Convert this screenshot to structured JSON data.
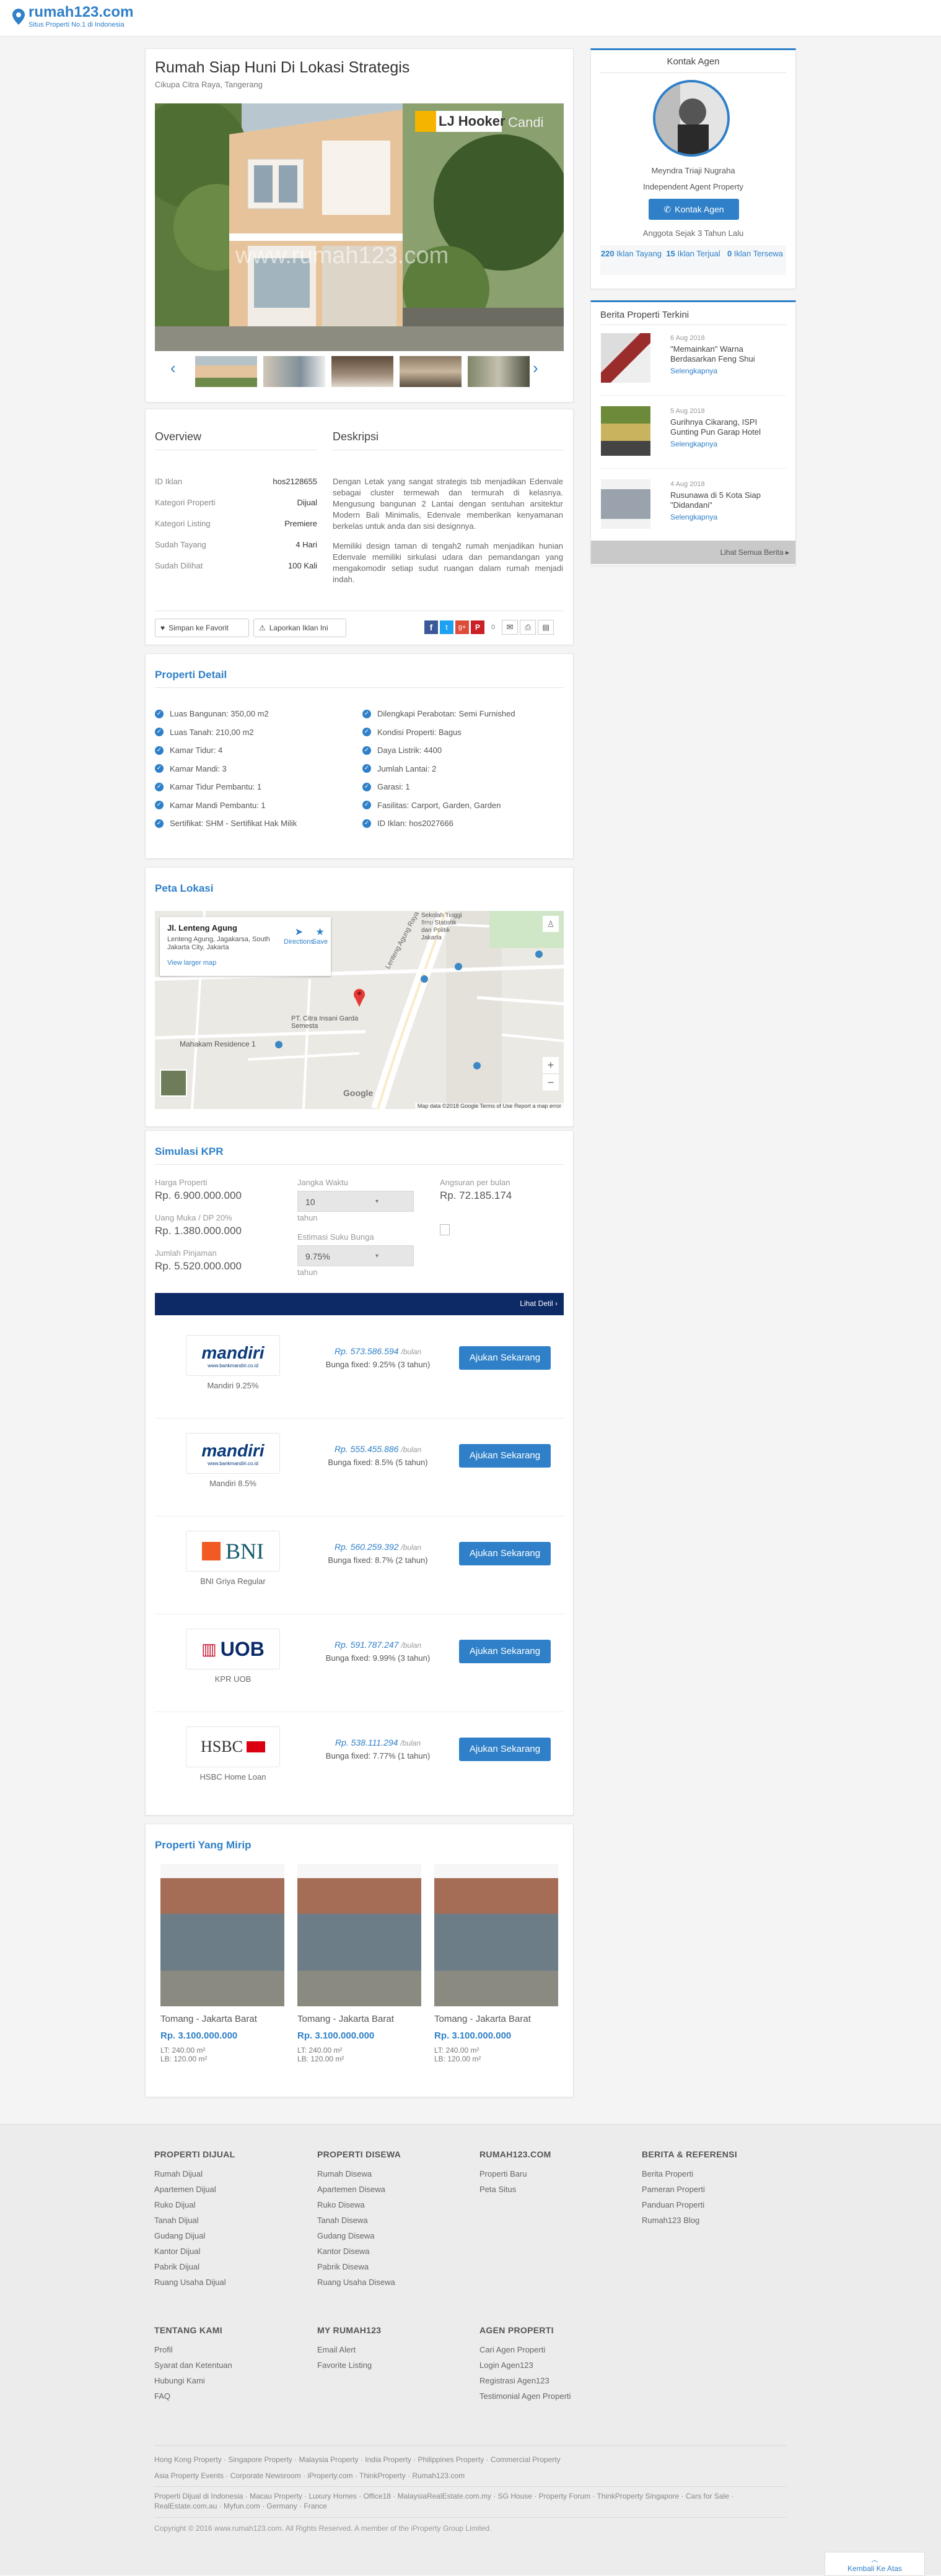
{
  "brand": {
    "name": "rumah123.com",
    "tagline": "Situs Properti No.1 di Indonesia",
    "accent": "#2f80c8"
  },
  "listing": {
    "title": "Rumah Siap Huni Di Lokasi Strategis",
    "location": "Cikupa Citra Raya, Tangerang",
    "watermark": "www.rumah123.com",
    "agency_sign": "LJ Hooker",
    "sign_extra": "Candi"
  },
  "overview": {
    "title": "Overview",
    "rows": [
      {
        "k": "ID Iklan",
        "v": "hos2128655"
      },
      {
        "k": "Kategori Properti",
        "v": "Dijual"
      },
      {
        "k": "Kategori Listing",
        "v": "Premiere"
      },
      {
        "k": "Sudah Tayang",
        "v": "4 Hari"
      },
      {
        "k": "Sudah Dilihat",
        "v": "100 Kali"
      }
    ]
  },
  "description": {
    "title": "Deskripsi",
    "p1": "Dengan Letak yang sangat strategis tsb menjadikan Edenvale sebagai cluster termewah dan termurah di kelasnya. Mengusung bangunan 2 Lantai dengan sentuhan arsitektur Modern Bali Minimalis, Edenvale memberikan kenyamanan berkelas untuk anda dan sisi designnya.",
    "p2": "Memiliki design taman di tengah2 rumah menjadikan hunian Edenvale memiliki sirkulasi udara dan pemandangan yang mengakomodir setiap sudut ruangan dalam rumah menjadi indah."
  },
  "actions": {
    "save_label": "Simpan ke Favorit",
    "report_label": "Laporkan Iklan Ini",
    "share_count": "0"
  },
  "detail": {
    "title": "Properti Detail",
    "left": [
      "Luas Bangunan: 350,00 m2",
      "Luas Tanah: 210,00 m2",
      "Kamar Tidur: 4",
      "Kamar Mandi: 3",
      "Kamar Tidur Pembantu: 1",
      "Kamar Mandi Pembantu: 1",
      "Sertifikat: SHM - Sertifikat Hak Milik"
    ],
    "right": [
      "Dilengkapi Perabotan: Semi Furnished",
      "Kondisi Properti: Bagus",
      "Daya Listrik: 4400",
      "Jumlah Lantai: 2",
      "Garasi: 1",
      "Fasilitas: Carport, Garden, Garden",
      "ID Iklan: hos2027666"
    ]
  },
  "map": {
    "title": "Peta Lokasi",
    "place_name": "Jl. Lenteng Agung",
    "place_addr": "Lenteng Agung, Jagakarsa, South Jakarta City, Jakarta",
    "larger_map": "View larger map",
    "directions": "Directions",
    "save": "Save",
    "street": "Lenteng Agung Raya",
    "poi1": "Mahakam Residence 1",
    "poi2": "PT. Citra Insani Garda Semesta",
    "poi3": "Sekolah Tinggi Ilmu Statistik dan Politik Jakarta",
    "footer": "Map data ©2018 Google   Terms of Use   Report a map error",
    "google": "Google"
  },
  "kpr": {
    "title": "Simulasi KPR",
    "harga_label": "Harga Properti",
    "harga": "Rp. 6.900.000.000",
    "dp_label": "Uang Muka / DP 20%",
    "dp": "Rp. 1.380.000.000",
    "pinjaman_label": "Jumlah Pinjaman",
    "pinjaman": "Rp. 5.520.000.000",
    "jangka_label": "Jangka Waktu",
    "jangka": "10",
    "jangka_unit": "tahun",
    "bunga_label": "Estimasi Suku Bunga",
    "bunga": "9.75%",
    "bunga_unit": "tahun",
    "angsuran_label": "Angsuran per bulan",
    "angsuran": "Rp. 72.185.174",
    "detail_link": "Lihat Detil ›",
    "banks": [
      {
        "logo": "mandiri",
        "logo_sub": "www.bankmandiri.co.id",
        "caption": "Mandiri 9.25%",
        "amount": "Rp. 573.586.594",
        "unit": "/bulan",
        "bunga": "Bunga fixed: 9.25% (3 tahun)",
        "btn": "Ajukan Sekarang"
      },
      {
        "logo": "mandiri",
        "logo_sub": "www.bankmandiri.co.id",
        "caption": "Mandiri 8.5%",
        "amount": "Rp. 555.455.886",
        "unit": "/bulan",
        "bunga": "Bunga fixed: 8.5% (5 tahun)",
        "btn": "Ajukan Sekarang"
      },
      {
        "logo": "BNI",
        "logo_sub": "",
        "caption": "BNI Griya Regular",
        "amount": "Rp. 560.259.392",
        "unit": "/bulan",
        "bunga": "Bunga fixed: 8.7% (2 tahun)",
        "btn": "Ajukan Sekarang"
      },
      {
        "logo": "UOB",
        "logo_sub": "",
        "caption": "KPR UOB",
        "amount": "Rp. 591.787.247",
        "unit": "/bulan",
        "bunga": "Bunga fixed: 9.99% (3 tahun)",
        "btn": "Ajukan Sekarang"
      },
      {
        "logo": "HSBC",
        "logo_sub": "",
        "caption": "HSBC Home Loan",
        "amount": "Rp. 538.111.294",
        "unit": "/bulan",
        "bunga": "Bunga fixed: 7.77% (1 tahun)",
        "btn": "Ajukan Sekarang"
      }
    ]
  },
  "similar": {
    "title": "Properti Yang Mirip",
    "items": [
      {
        "location": "Tomang - Jakarta Barat",
        "price": "Rp. 3.100.000.000",
        "lt": "LT: 240.00 m²",
        "lb": "LB: 120.00 m²"
      },
      {
        "location": "Tomang - Jakarta Barat",
        "price": "Rp. 3.100.000.000",
        "lt": "LT: 240.00 m²",
        "lb": "LB: 120.00 m²"
      },
      {
        "location": "Tomang - Jakarta Barat",
        "price": "Rp. 3.100.000.000",
        "lt": "LT: 240.00 m²",
        "lb": "LB: 120.00 m²"
      }
    ]
  },
  "agent": {
    "title": "Kontak Agen",
    "name": "Meyndra Triaji Nugraha",
    "role": "Independent Agent Property",
    "contact_btn": "Kontak Agen",
    "member_since": "Anggota Sejak 3 Tahun Lalu",
    "stats": [
      {
        "num": "220",
        "label": "Iklan Tayang"
      },
      {
        "num": "15",
        "label": "Iklan Terjual"
      },
      {
        "num": "0",
        "label": "Iklan Tersewa"
      }
    ]
  },
  "news": {
    "title": "Berita Properti Terkini",
    "items": [
      {
        "date": "6 Aug 2018",
        "title": "\"Memainkan\" Warna Berdasarkan Feng Shui",
        "more": "Selengkapnya"
      },
      {
        "date": "5 Aug 2018",
        "title": "Gurihnya Cikarang, ISPI Gunting Pun Garap Hotel",
        "more": "Selengkapnya"
      },
      {
        "date": "4 Aug 2018",
        "title": "Rusunawa di 5 Kota Siap \"Didandani\"",
        "more": "Selengkapnya"
      }
    ],
    "see_all": "Lihat Semua Berita ▸"
  },
  "footer": {
    "cols": [
      {
        "title": "PROPERTI DIJUAL",
        "items": [
          "Rumah Dijual",
          "Apartemen Dijual",
          "Ruko Dijual",
          "Tanah Dijual",
          "Gudang Dijual",
          "Kantor Dijual",
          "Pabrik Dijual",
          "Ruang Usaha Dijual"
        ]
      },
      {
        "title": "PROPERTI DISEWA",
        "items": [
          "Rumah Disewa",
          "Apartemen Disewa",
          "Ruko Disewa",
          "Tanah Disewa",
          "Gudang Disewa",
          "Kantor Disewa",
          "Pabrik Disewa",
          "Ruang Usaha Disewa"
        ]
      },
      {
        "title": "RUMAH123.COM",
        "items": [
          "Properti Baru",
          "Peta Situs"
        ]
      },
      {
        "title": "BERITA & REFERENSI",
        "items": [
          "Berita Properti",
          "Pameran Properti",
          "Panduan Properti",
          "Rumah123 Blog"
        ]
      }
    ],
    "cols2": [
      {
        "title": "TENTANG KAMI",
        "items": [
          "Profil",
          "Syarat dan Ketentuan",
          "Hubungi Kami",
          "FAQ"
        ]
      },
      {
        "title": "MY RUMAH123",
        "items": [
          "Email Alert",
          "Favorite Listing"
        ]
      },
      {
        "title": "AGEN PROPERTI",
        "items": [
          "Cari Agen Properti",
          "Login Agen123",
          "Registrasi Agen123",
          "Testimonial Agen Properti"
        ]
      }
    ],
    "links1": "Hong Kong Property · Singapore Property · Malaysia Property · India Property · Philippines Property · Commercial Property",
    "links2": "Asia Property Events · Corporate Newsroom · iProperty.com · ThinkProperty · Rumah123.com",
    "links3": "Properti Dijual di Indonesia · Macau Property · Luxury Homes · Office18 · MalaysiaRealEstate.com.my · SG House · Property Forum · ThinkProperty Singapore · Cars for Sale · RealEstate.com.au · Myfun.com · Germany · France",
    "copyright": "Copyright © 2016 www.rumah123.com. All Rights Reserved. A member of the iProperty Group Limited.",
    "back_top": "Kembali Ke Atas"
  }
}
